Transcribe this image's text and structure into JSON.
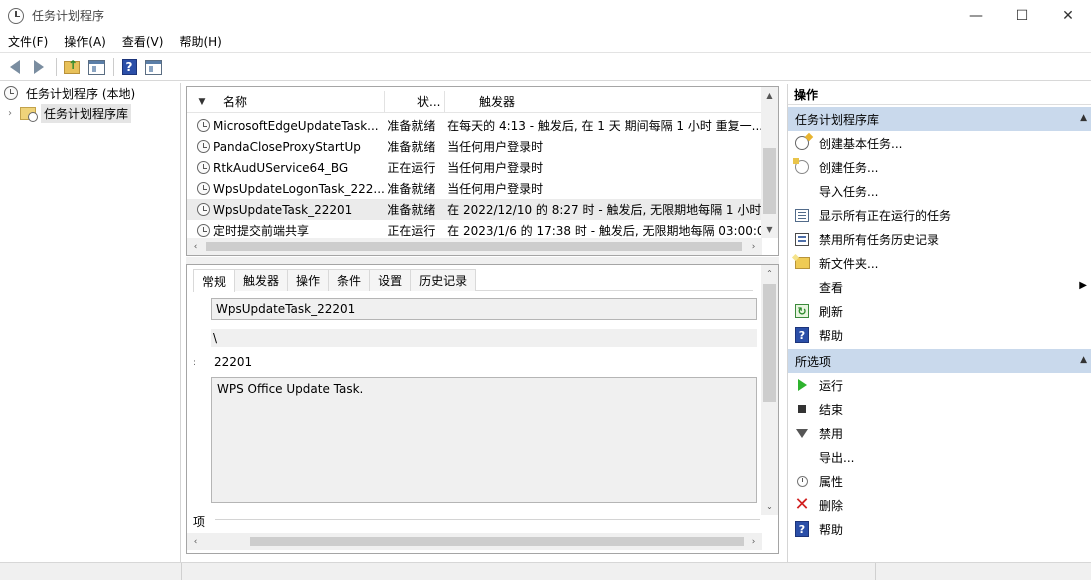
{
  "window": {
    "title": "任务计划程序",
    "minimize_glyph": "—",
    "maximize_glyph": "☐",
    "close_glyph": "✕"
  },
  "menu": [
    "文件(F)",
    "操作(A)",
    "查看(V)",
    "帮助(H)"
  ],
  "toolbar": {
    "icons": [
      "back-arrow-icon",
      "forward-arrow-icon",
      "folder-up-icon",
      "show-hide-console-tree-icon",
      "help-icon",
      "action-pane-icon"
    ],
    "help_glyph": "?"
  },
  "tree": {
    "root": "任务计划程序 (本地)",
    "child": "任务计划程序库",
    "child_chevron": "›"
  },
  "task_list": {
    "sort_glyph": "▼",
    "columns": {
      "name": "名称",
      "status": "状...",
      "trigger": "触发器"
    },
    "rows": [
      {
        "name": "MicrosoftEdgeUpdateTask...",
        "status": "准备就绪",
        "trigger": "在每天的 4:13 - 触发后, 在 1 天 期间每隔 1 小时 重复一..."
      },
      {
        "name": "PandaCloseProxyStartUp",
        "status": "准备就绪",
        "trigger": "当任何用户登录时"
      },
      {
        "name": "RtkAudUService64_BG",
        "status": "正在运行",
        "trigger": "当任何用户登录时"
      },
      {
        "name": "WpsUpdateLogonTask_222...",
        "status": "准备就绪",
        "trigger": "当任何用户登录时"
      },
      {
        "name": "WpsUpdateTask_22201",
        "status": "准备就绪",
        "trigger": "在 2022/12/10 的 8:27 时 - 触发后, 无限期地每隔 1 小时"
      },
      {
        "name": "定时提交前端共享",
        "status": "正在运行",
        "trigger": "在 2023/1/6 的 17:38 时 - 触发后, 无限期地每隔 03:00:0"
      }
    ],
    "selected_index": 4
  },
  "details": {
    "tabs": [
      "常规",
      "触发器",
      "操作",
      "条件",
      "设置",
      "历史记录"
    ],
    "active_tab": 0,
    "name_value": "WpsUpdateTask_22201",
    "location_value": "\\",
    "author_value": "22201",
    "colon_mark": ":",
    "description_value": "WPS Office Update Task.",
    "section_label": "项"
  },
  "scroll": {
    "up": "▲",
    "down": "▼",
    "left": "‹",
    "right": "›",
    "down_chevron": "⌄",
    "up_chevron": "⌃"
  },
  "actions": {
    "header": "操作",
    "section1": {
      "title": "任务计划程序库",
      "items": [
        {
          "label": "创建基本任务...",
          "icon": "create-basic-task-icon"
        },
        {
          "label": "创建任务...",
          "icon": "create-task-icon"
        },
        {
          "label": "导入任务...",
          "icon": ""
        },
        {
          "label": "显示所有正在运行的任务",
          "icon": "running-tasks-icon"
        },
        {
          "label": "禁用所有任务历史记录",
          "icon": "history-icon"
        },
        {
          "label": "新文件夹...",
          "icon": "new-folder-icon"
        },
        {
          "label": "查看",
          "icon": "",
          "submenu": true
        },
        {
          "label": "刷新",
          "icon": "refresh-icon"
        },
        {
          "label": "帮助",
          "icon": "help-icon"
        }
      ]
    },
    "section2": {
      "title": "所选项",
      "items": [
        {
          "label": "运行",
          "icon": "run-icon"
        },
        {
          "label": "结束",
          "icon": "stop-icon"
        },
        {
          "label": "禁用",
          "icon": "disable-icon"
        },
        {
          "label": "导出...",
          "icon": ""
        },
        {
          "label": "属性",
          "icon": "properties-icon"
        },
        {
          "label": "删除",
          "icon": "delete-icon"
        },
        {
          "label": "帮助",
          "icon": "help-icon"
        }
      ]
    },
    "caret_glyph": "▲",
    "submenu_glyph": "▶",
    "refresh_glyph": "↻",
    "help_glyph": "?",
    "delete_glyph": "✕"
  }
}
